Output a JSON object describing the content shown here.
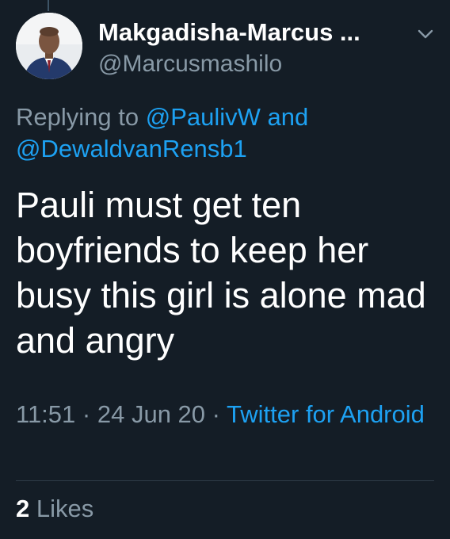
{
  "author": {
    "display_name": "Makgadisha-Marcus ...",
    "handle": "@Marcusmashilo"
  },
  "reply": {
    "prefix": "Replying to",
    "mention_1": "@PaulivW",
    "joiner": "and",
    "mention_2": "@DewaldvanRensb1"
  },
  "tweet": {
    "text": "Pauli must get ten boyfriends to keep her busy this girl is alone mad and angry"
  },
  "meta": {
    "time": "11:51",
    "separator": "·",
    "date": "24 Jun 20",
    "source": "Twitter for Android"
  },
  "stats": {
    "likes_count": "2",
    "likes_label": "Likes"
  },
  "icons": {
    "caret": "chevron-down-icon",
    "avatar": "profile-photo"
  },
  "colors": {
    "background": "#141d26",
    "accent": "#1da1f2",
    "secondary_text": "#8899a6",
    "primary_text": "#ffffff"
  }
}
